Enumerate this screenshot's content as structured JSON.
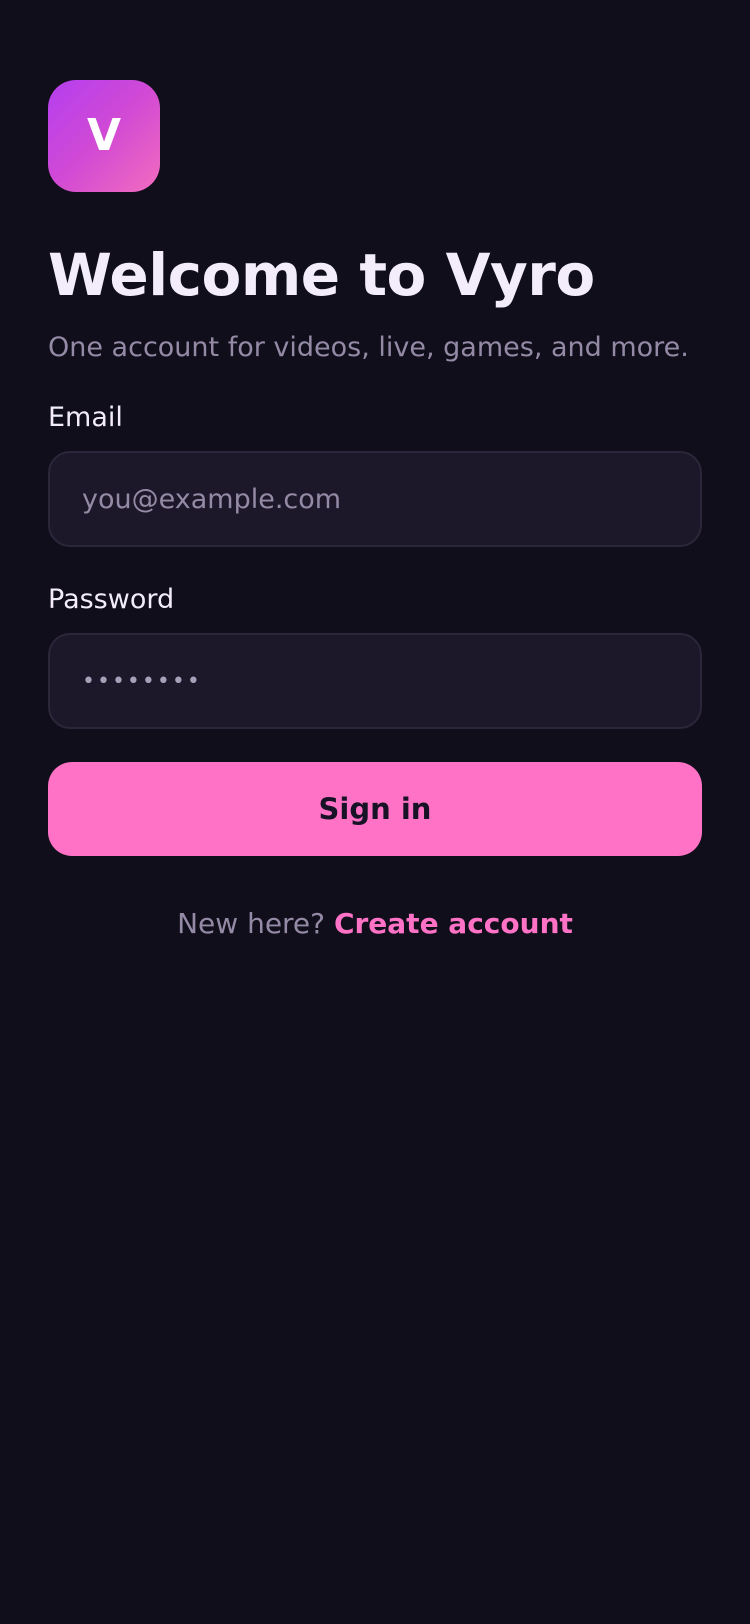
{
  "logo": {
    "letter": "V",
    "gradient_start": "#b43ef0",
    "gradient_end": "#f26cbf"
  },
  "header": {
    "title": "Welcome to Vyro",
    "subtitle": "One account for videos, live, games, and more."
  },
  "form": {
    "email": {
      "label": "Email",
      "placeholder": "you@example.com",
      "value": ""
    },
    "password": {
      "label": "Password",
      "value": "••••••••"
    },
    "submit_label": "Sign in"
  },
  "footer": {
    "prompt": "New here?",
    "link_label": "Create account"
  },
  "colors": {
    "background": "#100e1a",
    "accent": "#ff72c6",
    "input_background": "#1c1829",
    "muted_text": "#948aa6"
  }
}
